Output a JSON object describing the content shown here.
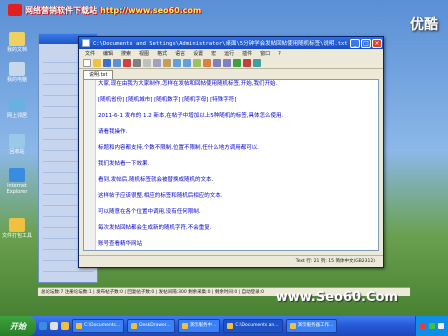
{
  "banner": {
    "text": "网络营销软件下载站",
    "url": "http://www.seo60.com"
  },
  "brand": "优酷",
  "watermark_url": "www.Seo60.Com",
  "desktop_icons": [
    {
      "label": "我的文档"
    },
    {
      "label": "我的电脑"
    },
    {
      "label": "网上邻居"
    },
    {
      "label": "回收站"
    },
    {
      "label": "Internet Explorer"
    },
    {
      "label": "文件打包工具"
    }
  ],
  "editor": {
    "title": "C:\\Documents and Settings\\Administrator\\桌面\\5分钟学会发帖回帖使用随机标签\\说明.txt",
    "menu": [
      "文件",
      "编辑",
      "搜索",
      "视图",
      "格式",
      "语言",
      "设置",
      "宏",
      "运行",
      "插件",
      "窗口",
      "?"
    ],
    "tab": "说明.txt",
    "lines": [
      "大家,现在由我为大家制作,怎样在发帖和回帖使用随机标签,开始,我们开始.",
      "",
      "[随机省份]  [随机城市]  [随机数字]  [随机字母]  [特殊字符]",
      "",
      "2011-6-1 发布的 1.2 新本,在帖子中增加以上5种随机的标签,具体怎么使用.",
      "",
      "请看我操作.",
      "",
      "标题和内容都支持,个数不限制,位置不限制,任什么地方调用都可以.",
      "",
      "我们发帖看一下效果.",
      "",
      "看到,发帖后,随机标签就会被替换成随机的文本.",
      "",
      "这样帖子应该很整,相应的标签和随机后相应的文本.",
      "",
      "可以随意在各个位置中调用,没有任何限制.",
      "",
      "每次发帖回帖都会生成新的随机字符,不会重复.",
      "",
      "账号查看精华网站"
    ],
    "status": "Text  行: 21   列: 15   简体中文(GB2312)"
  },
  "app_status": "总论坛数:7  注册论坛数:1 | 发布帖子数:0 | 回复帖子数:0 | 发帖间隔:300 剩余采集:0 | 剩余时间:0 | 自动登录:0",
  "taskbar": {
    "start": "开始",
    "tasks": [
      {
        "label": "C:\\Documents...",
        "active": false
      },
      {
        "label": "DeskDrawer...",
        "active": false
      },
      {
        "label": "演示服务中...",
        "active": false
      },
      {
        "label": "C:\\Documents an...",
        "active": true
      },
      {
        "label": "演示服务器工作...",
        "active": false
      }
    ]
  }
}
